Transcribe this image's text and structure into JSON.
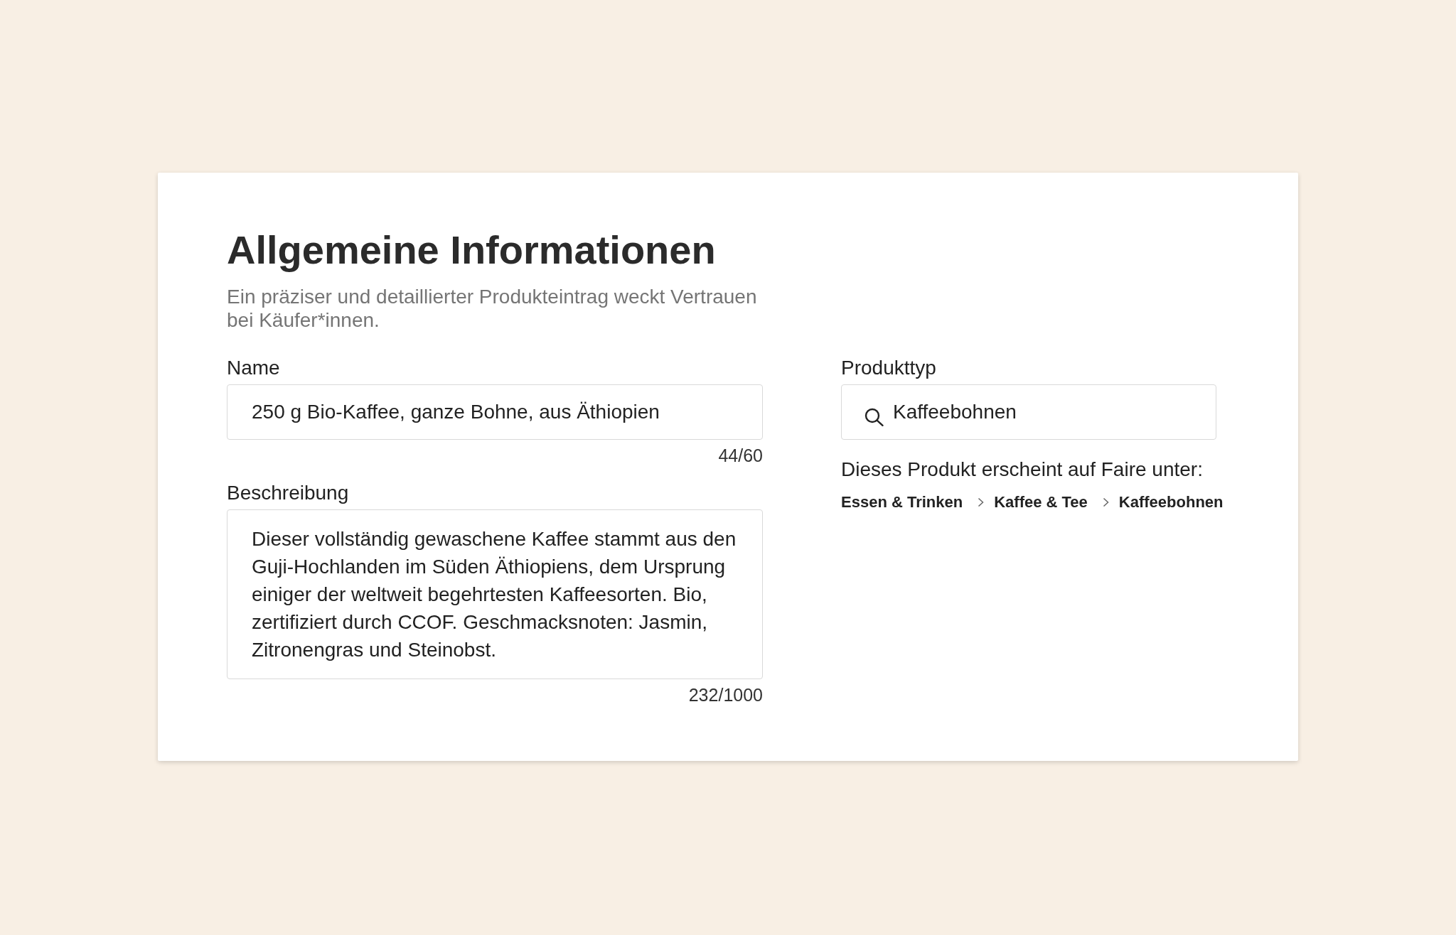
{
  "section": {
    "title": "Allgemeine Informationen",
    "description": "Ein präziser und detaillierter Produkteintrag weckt Vertrauen bei Käufer*innen."
  },
  "main_fields": [
    {
      "kind": "text",
      "label": "Name",
      "value": "250 g Bio-Kaffee, ganze Bohne, aus Äthiopien",
      "counter": "44/60"
    },
    {
      "kind": "textarea",
      "label": "Beschreibung",
      "value": "Dieser vollständig gewaschene Kaffee stammt aus den Guji-Hochlanden im Süden Äthiopiens, dem Ursprung einiger der weltweit begehrtesten Kaffeesorten. Bio, zertifiziert durch CCOF. Geschmacksnoten: Jasmin, Zitronengras und Steinobst.",
      "counter": "232/1000"
    }
  ],
  "product_type": {
    "label": "Produkttyp",
    "value": "Kaffeebohnen",
    "note": "Dieses Produkt erscheint auf Faire unter:",
    "breadcrumb": [
      "Essen & Trinken",
      "Kaffee & Tee",
      "Kaffeebohnen"
    ]
  }
}
